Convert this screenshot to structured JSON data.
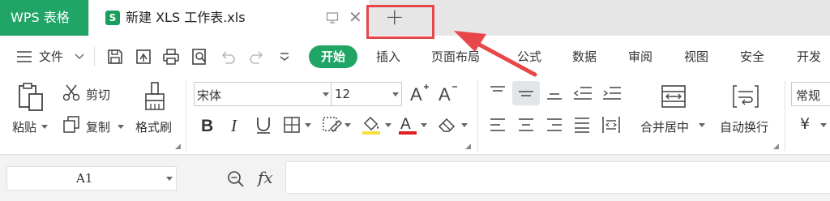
{
  "tabbar": {
    "app_tab": "WPS 表格",
    "doc_icon_letter": "S",
    "doc_tab_title": "新建 XLS 工作表.xls",
    "new_tab_symbol": "+",
    "close_symbol": "✕",
    "highlight_color": "#e8474a"
  },
  "menubar": {
    "file_label": "文件",
    "tabs": [
      "开始",
      "插入",
      "页面布局",
      "公式",
      "数据",
      "审阅",
      "视图",
      "安全",
      "开发工"
    ]
  },
  "ribbon": {
    "paste": "粘贴",
    "cut": "剪切",
    "copy": "复制",
    "format_painter": "格式刷",
    "font_name": "宋体",
    "font_size": "12",
    "merge_center": "合并居中",
    "wrap_text": "自动换行",
    "number_format": "常规",
    "currency_symbol": "¥"
  },
  "formulabar": {
    "name_box": "A1",
    "fx": "fx"
  },
  "colors": {
    "brand_green": "#21a566",
    "font_color_bar": "#e02020",
    "fill_color_bar": "#f4e23c"
  }
}
